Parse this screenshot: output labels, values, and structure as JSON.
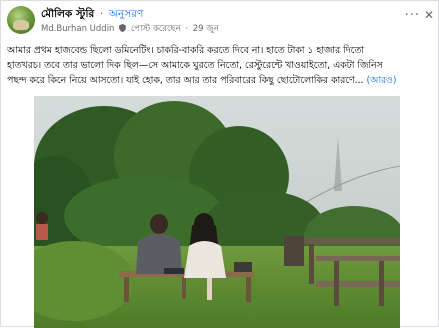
{
  "post": {
    "group_name": "মৌলিক স্টুরি",
    "separator": "·",
    "follow_label": "অনুসরণ",
    "author": "Md.Burhan Uddin",
    "role_label": "পোস্ট করেছেন",
    "date": "29 জুন",
    "more_icon": "more-horizontal-icon",
    "close_icon": "close-icon",
    "text_line1": "আমার প্রথম হাজবেন্ড ছিলো ডমিনেটিং। চাকরি-বাকরি করতে দিবে না। হাতে টাকা ১ হাজার দিতো",
    "text_line2": "হাতখরচ। তবে তার ভালো দিক ছিল—সে আমাকে ঘুরতে নিতো, রেস্টুরেন্টে খাওয়াইতো, একটা জিনিস",
    "text_line3": "পছন্দ করে কিনে নিয়ে আসতো। যাই হোক, তার আর তার পরিবারের কিছু ছোটোলোকির কারণে...",
    "see_more": "(আরও)"
  },
  "colors": {
    "link": "#1877f2",
    "secondary_text": "#65676b",
    "primary_text": "#050505",
    "border": "#dadde1"
  }
}
